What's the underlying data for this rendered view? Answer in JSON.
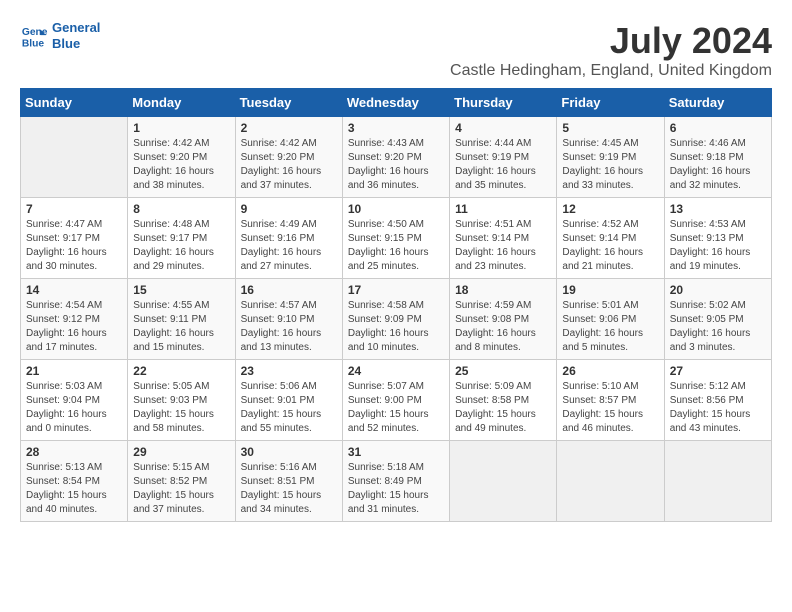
{
  "logo": {
    "line1": "General",
    "line2": "Blue"
  },
  "title": "July 2024",
  "subtitle": "Castle Hedingham, England, United Kingdom",
  "days_of_week": [
    "Sunday",
    "Monday",
    "Tuesday",
    "Wednesday",
    "Thursday",
    "Friday",
    "Saturday"
  ],
  "weeks": [
    [
      {
        "day": "",
        "info": ""
      },
      {
        "day": "1",
        "info": "Sunrise: 4:42 AM\nSunset: 9:20 PM\nDaylight: 16 hours\nand 38 minutes."
      },
      {
        "day": "2",
        "info": "Sunrise: 4:42 AM\nSunset: 9:20 PM\nDaylight: 16 hours\nand 37 minutes."
      },
      {
        "day": "3",
        "info": "Sunrise: 4:43 AM\nSunset: 9:20 PM\nDaylight: 16 hours\nand 36 minutes."
      },
      {
        "day": "4",
        "info": "Sunrise: 4:44 AM\nSunset: 9:19 PM\nDaylight: 16 hours\nand 35 minutes."
      },
      {
        "day": "5",
        "info": "Sunrise: 4:45 AM\nSunset: 9:19 PM\nDaylight: 16 hours\nand 33 minutes."
      },
      {
        "day": "6",
        "info": "Sunrise: 4:46 AM\nSunset: 9:18 PM\nDaylight: 16 hours\nand 32 minutes."
      }
    ],
    [
      {
        "day": "7",
        "info": "Sunrise: 4:47 AM\nSunset: 9:17 PM\nDaylight: 16 hours\nand 30 minutes."
      },
      {
        "day": "8",
        "info": "Sunrise: 4:48 AM\nSunset: 9:17 PM\nDaylight: 16 hours\nand 29 minutes."
      },
      {
        "day": "9",
        "info": "Sunrise: 4:49 AM\nSunset: 9:16 PM\nDaylight: 16 hours\nand 27 minutes."
      },
      {
        "day": "10",
        "info": "Sunrise: 4:50 AM\nSunset: 9:15 PM\nDaylight: 16 hours\nand 25 minutes."
      },
      {
        "day": "11",
        "info": "Sunrise: 4:51 AM\nSunset: 9:14 PM\nDaylight: 16 hours\nand 23 minutes."
      },
      {
        "day": "12",
        "info": "Sunrise: 4:52 AM\nSunset: 9:14 PM\nDaylight: 16 hours\nand 21 minutes."
      },
      {
        "day": "13",
        "info": "Sunrise: 4:53 AM\nSunset: 9:13 PM\nDaylight: 16 hours\nand 19 minutes."
      }
    ],
    [
      {
        "day": "14",
        "info": "Sunrise: 4:54 AM\nSunset: 9:12 PM\nDaylight: 16 hours\nand 17 minutes."
      },
      {
        "day": "15",
        "info": "Sunrise: 4:55 AM\nSunset: 9:11 PM\nDaylight: 16 hours\nand 15 minutes."
      },
      {
        "day": "16",
        "info": "Sunrise: 4:57 AM\nSunset: 9:10 PM\nDaylight: 16 hours\nand 13 minutes."
      },
      {
        "day": "17",
        "info": "Sunrise: 4:58 AM\nSunset: 9:09 PM\nDaylight: 16 hours\nand 10 minutes."
      },
      {
        "day": "18",
        "info": "Sunrise: 4:59 AM\nSunset: 9:08 PM\nDaylight: 16 hours\nand 8 minutes."
      },
      {
        "day": "19",
        "info": "Sunrise: 5:01 AM\nSunset: 9:06 PM\nDaylight: 16 hours\nand 5 minutes."
      },
      {
        "day": "20",
        "info": "Sunrise: 5:02 AM\nSunset: 9:05 PM\nDaylight: 16 hours\nand 3 minutes."
      }
    ],
    [
      {
        "day": "21",
        "info": "Sunrise: 5:03 AM\nSunset: 9:04 PM\nDaylight: 16 hours\nand 0 minutes."
      },
      {
        "day": "22",
        "info": "Sunrise: 5:05 AM\nSunset: 9:03 PM\nDaylight: 15 hours\nand 58 minutes."
      },
      {
        "day": "23",
        "info": "Sunrise: 5:06 AM\nSunset: 9:01 PM\nDaylight: 15 hours\nand 55 minutes."
      },
      {
        "day": "24",
        "info": "Sunrise: 5:07 AM\nSunset: 9:00 PM\nDaylight: 15 hours\nand 52 minutes."
      },
      {
        "day": "25",
        "info": "Sunrise: 5:09 AM\nSunset: 8:58 PM\nDaylight: 15 hours\nand 49 minutes."
      },
      {
        "day": "26",
        "info": "Sunrise: 5:10 AM\nSunset: 8:57 PM\nDaylight: 15 hours\nand 46 minutes."
      },
      {
        "day": "27",
        "info": "Sunrise: 5:12 AM\nSunset: 8:56 PM\nDaylight: 15 hours\nand 43 minutes."
      }
    ],
    [
      {
        "day": "28",
        "info": "Sunrise: 5:13 AM\nSunset: 8:54 PM\nDaylight: 15 hours\nand 40 minutes."
      },
      {
        "day": "29",
        "info": "Sunrise: 5:15 AM\nSunset: 8:52 PM\nDaylight: 15 hours\nand 37 minutes."
      },
      {
        "day": "30",
        "info": "Sunrise: 5:16 AM\nSunset: 8:51 PM\nDaylight: 15 hours\nand 34 minutes."
      },
      {
        "day": "31",
        "info": "Sunrise: 5:18 AM\nSunset: 8:49 PM\nDaylight: 15 hours\nand 31 minutes."
      },
      {
        "day": "",
        "info": ""
      },
      {
        "day": "",
        "info": ""
      },
      {
        "day": "",
        "info": ""
      }
    ]
  ]
}
